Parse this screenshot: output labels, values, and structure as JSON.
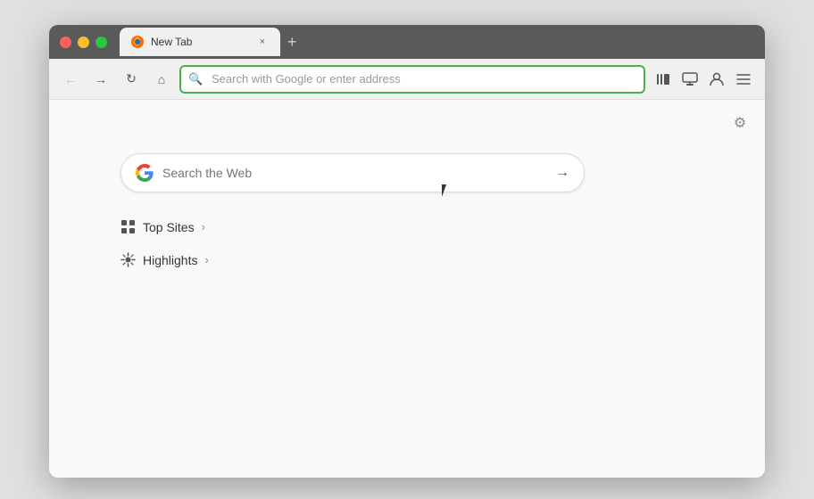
{
  "window": {
    "title": "New Tab"
  },
  "controls": {
    "close": "×",
    "min": "−",
    "max": "+"
  },
  "tab": {
    "title": "New Tab",
    "close_label": "×"
  },
  "nav": {
    "back_label": "←",
    "forward_label": "→",
    "reload_label": "↻",
    "home_label": "⌂",
    "new_tab_label": "+",
    "address_placeholder": "Search with Google or enter address",
    "library_label": "📚",
    "synced_tabs_label": "⊞",
    "account_label": "👤",
    "menu_label": "≡"
  },
  "page": {
    "gear_label": "⚙",
    "google_search_placeholder": "Search the Web",
    "google_arrow": "→",
    "top_sites_label": "Top Sites",
    "highlights_label": "Highlights"
  }
}
